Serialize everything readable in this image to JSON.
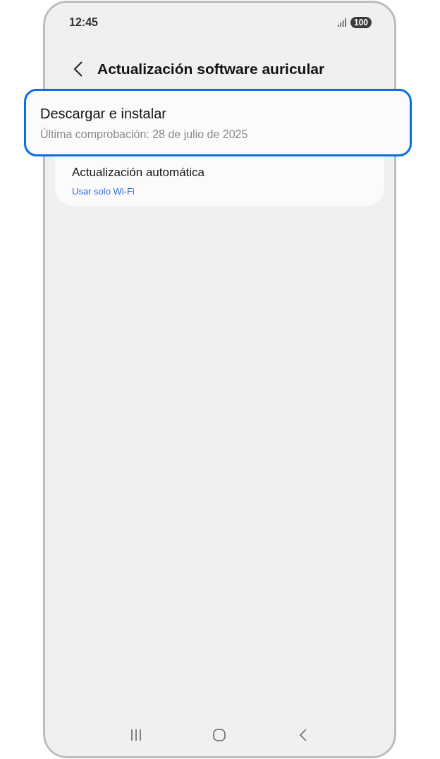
{
  "status_bar": {
    "time": "12:45",
    "battery": "100"
  },
  "header": {
    "title": "Actualización software auricular"
  },
  "settings": [
    {
      "title": "Descargar e instalar",
      "subtitle": "Última comprobación: 28 de julio de 2025",
      "kind": "info",
      "highlighted": true
    },
    {
      "title": "Actualización automática",
      "subtitle": "Usar solo Wi-Fi",
      "kind": "value",
      "highlighted": false
    }
  ]
}
